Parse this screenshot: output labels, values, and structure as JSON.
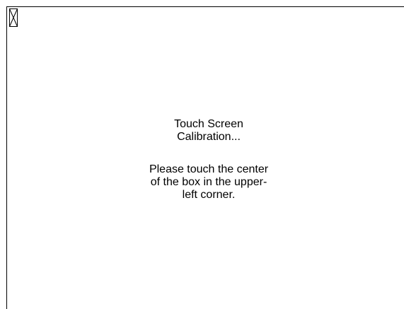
{
  "calibration": {
    "title_line1": "Touch Screen",
    "title_line2": "Calibration...",
    "instruction_line1": "Please touch the center",
    "instruction_line2": "of the box in the upper-",
    "instruction_line3": "left corner."
  },
  "target": {
    "icon": "calibration-target-box-icon",
    "corner": "upper-left"
  },
  "colors": {
    "background": "#ffffff",
    "foreground": "#000000"
  }
}
